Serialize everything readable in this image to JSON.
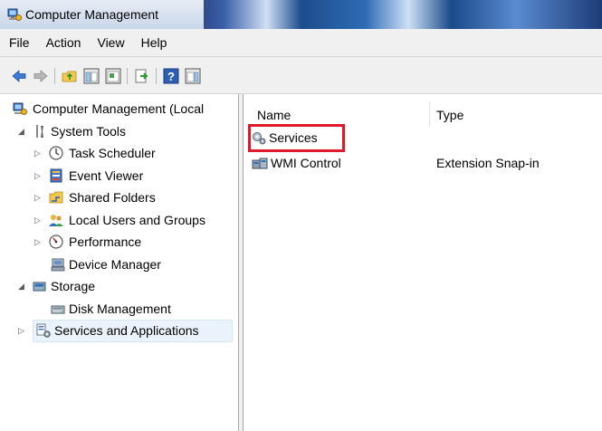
{
  "window": {
    "title": "Computer Management"
  },
  "menu": [
    "File",
    "Action",
    "View",
    "Help"
  ],
  "toolbar": {
    "buttons": [
      "back-arrow-icon",
      "forward-arrow-icon",
      "up-folder-icon",
      "show-hide-console-tree-icon",
      "properties-icon",
      "export-list-icon",
      "help-icon",
      "action-pane-icon"
    ]
  },
  "tree": {
    "root": "Computer Management (Local",
    "system_tools": "System Tools",
    "task_scheduler": "Task Scheduler",
    "event_viewer": "Event Viewer",
    "shared_folders": "Shared Folders",
    "local_users": "Local Users and Groups",
    "performance": "Performance",
    "device_manager": "Device Manager",
    "storage": "Storage",
    "disk_management": "Disk Management",
    "services_apps": "Services and Applications"
  },
  "list": {
    "columns": [
      "Name",
      "Type"
    ],
    "rows": [
      {
        "name": "Services",
        "type": ""
      },
      {
        "name": "WMI Control",
        "type": "Extension Snap-in"
      }
    ]
  },
  "colors": {
    "highlight": "#e0182c",
    "selection": "#eaf3fb"
  }
}
